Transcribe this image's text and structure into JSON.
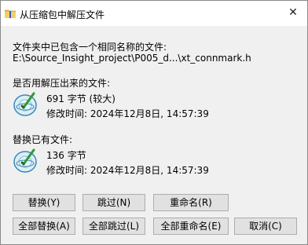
{
  "dialog": {
    "title": "从压缩包中解压文件"
  },
  "message": {
    "line1": "文件夹中已包含一个相同名称的文件:",
    "path": "E:\\Source_Insight_project\\P005_d...\\xt_connmark.h"
  },
  "extract_section": {
    "heading": "是否用解压出来的文件:",
    "size": "691 字节  (较大)",
    "modified": "修改时间: 2024年12月8日, 14:57:39"
  },
  "existing_section": {
    "heading": "替换已有文件:",
    "size": "136 字节",
    "modified": "修改时间: 2024年12月8日, 14:57:39"
  },
  "buttons": {
    "replace": "替换(Y)",
    "skip": "跳过(N)",
    "rename": "重命名(R)",
    "replace_all": "全部替换(A)",
    "skip_all": "全部跳过(L)",
    "rename_all": "全部重命名(E)",
    "cancel": "取消(C)"
  },
  "icons": {
    "title": "folder-zip-icon",
    "extract_file": "disc-file-icon",
    "existing_file": "disc-file-icon",
    "close": "close-icon"
  }
}
